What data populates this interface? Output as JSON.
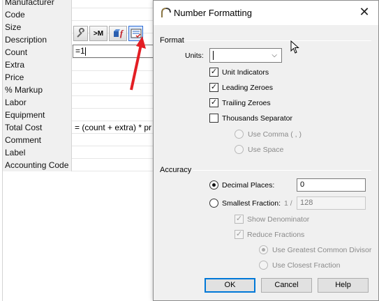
{
  "properties": {
    "rows": [
      {
        "label": "Manufacturer",
        "value": ""
      },
      {
        "label": "Code",
        "value": ""
      },
      {
        "label": "Size",
        "value": ""
      },
      {
        "label": "Description",
        "value": ""
      },
      {
        "label": "Count",
        "value": "=1"
      },
      {
        "label": "Extra",
        "value": ""
      },
      {
        "label": "Price",
        "value": ""
      },
      {
        "label": "% Markup",
        "value": ""
      },
      {
        "label": "Labor",
        "value": ""
      },
      {
        "label": "Equipment",
        "value": ""
      },
      {
        "label": "Total Cost",
        "value": "= (count + extra) * pr"
      },
      {
        "label": "Comment",
        "value": ""
      },
      {
        "label": "Label",
        "value": ""
      },
      {
        "label": "Accounting Code",
        "value": ""
      }
    ],
    "count_input_value": "=1",
    "toolbar": {
      "m_button_label": ">M",
      "f_button_label": "f"
    }
  },
  "dialog": {
    "title": "Number Formatting",
    "format": {
      "group_label": "Format",
      "units_label": "Units:",
      "units_value": "",
      "unit_indicators": {
        "label": "Unit Indicators",
        "checked": true
      },
      "leading_zeroes": {
        "label": "Leading Zeroes",
        "checked": true
      },
      "trailing_zeroes": {
        "label": "Trailing Zeroes",
        "checked": true
      },
      "thousands_separator": {
        "label": "Thousands Separator",
        "checked": false
      },
      "use_comma": {
        "label": "Use Comma ( , )",
        "enabled": false
      },
      "use_space": {
        "label": "Use Space",
        "enabled": false
      }
    },
    "accuracy": {
      "group_label": "Accuracy",
      "decimal_places": {
        "label": "Decimal Places:",
        "value": "0",
        "selected": true
      },
      "smallest_fraction": {
        "label": "Smallest Fraction:",
        "prefix": "1 /",
        "value": "128",
        "selected": false
      },
      "show_denominator": {
        "label": "Show Denominator",
        "checked": true,
        "enabled": false
      },
      "reduce_fractions": {
        "label": "Reduce Fractions",
        "checked": true,
        "enabled": false
      },
      "use_gcd": {
        "label": "Use Greatest Common Divisor",
        "selected": true,
        "enabled": false
      },
      "use_closest": {
        "label": "Use Closest Fraction",
        "selected": false,
        "enabled": false
      }
    },
    "buttons": {
      "ok": "OK",
      "cancel": "Cancel",
      "help": "Help"
    }
  },
  "colors": {
    "accent": "#0078d7",
    "arrow": "#e31e24"
  }
}
